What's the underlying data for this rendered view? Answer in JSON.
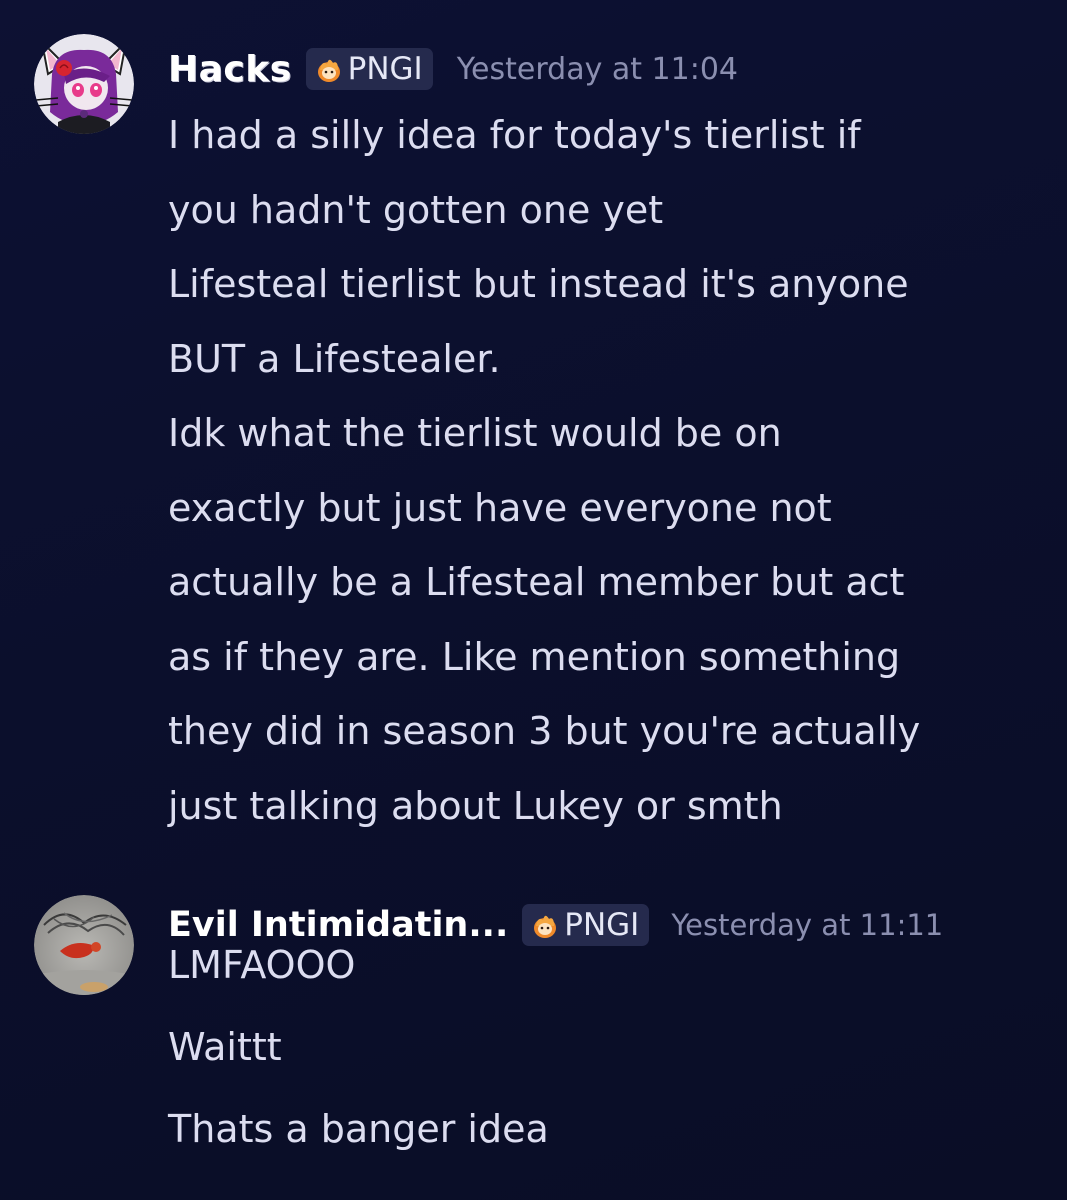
{
  "messages": [
    {
      "username": "Hacks",
      "tag": "PNGI",
      "timestamp": "Yesterday at 11:04",
      "avatar_icon": "cat-ear-avatar-icon",
      "lines": [
        "I had a silly idea for today's tierlist if",
        "you hadn't gotten one yet",
        "Lifesteal tierlist but instead it's anyone",
        "BUT a Lifestealer.",
        "Idk what the tierlist would be on",
        "exactly but just have everyone not",
        "actually be a Lifesteal member but act",
        "as if they are. Like mention something",
        "they did in season 3 but you're actually",
        "just talking about Lukey or smth"
      ]
    },
    {
      "username": "Evil Intimidatin...",
      "tag": "PNGI",
      "timestamp": "Yesterday at 11:11",
      "avatar_icon": "photo-avatar-icon",
      "lines": [
        "LMFAOOO",
        "Waittt",
        "Thats a banger idea"
      ]
    }
  ],
  "colors": {
    "background": "#0b0f2c",
    "text": "#dcddf0",
    "username": "#ffffff",
    "timestamp": "#8b8fb0",
    "tag_bg": "#252a4d",
    "flame": "#f08a2a"
  }
}
